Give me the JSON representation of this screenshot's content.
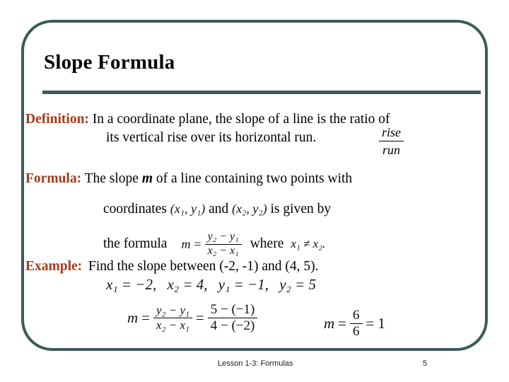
{
  "slide": {
    "title": "Slope Formula",
    "accent_color": "#3b5b59",
    "label_color": "#a63a1b",
    "text_color": "#000000",
    "background_color": "#ffffff"
  },
  "definition": {
    "label": "Definition:",
    "line1": "In a coordinate plane, the slope of a line is the ratio of",
    "line2": "its vertical rise over its horizontal run.",
    "fraction": {
      "numerator": "rise",
      "denominator": "run"
    }
  },
  "formula": {
    "label": "Formula:",
    "line1_before_m": "The slope",
    "m_symbol": "m",
    "line1_after_m": "of a line containing two points with",
    "line2_prefix": "coordinates",
    "point1": "(x₁, y₁)",
    "point2": "(x₂, y₂)",
    "line2_conjunction": "and",
    "line2_suffix": "is given by",
    "line3_prefix": "the formula",
    "m_var": "m",
    "equals": "=",
    "numerator": "y₂ − y₁",
    "denominator": "x₂ − x₁",
    "line3_where": "where",
    "condition": "x₁ ≠ x₂.",
    "num_y2": "y",
    "num_y2_sub": "2",
    "num_minus": "−",
    "num_y1": "y",
    "num_y1_sub": "1",
    "den_x2": "x",
    "den_x2_sub": "2",
    "den_minus": "−",
    "den_x1": "x",
    "den_x1_sub": "1"
  },
  "example": {
    "label": "Example:",
    "prompt": "Find the slope between (-2, -1) and (4, 5).",
    "values": {
      "x1": "x₁ = −2,",
      "x2": "x₂ = 4,",
      "y1": "y₁ = −1,",
      "y2": "y₂ = 5"
    },
    "work": {
      "m": "m",
      "eq1": "=",
      "frac1_num": "y₂ − y₁",
      "frac1_den": "x₂ − x₁",
      "eq2": "=",
      "frac2_num": "5 − (−1)",
      "frac2_den": "4 − (−2)"
    },
    "result": {
      "m": "m",
      "eq1": "=",
      "frac_num": "6",
      "frac_den": "6",
      "eq2": "=",
      "value": "1"
    }
  },
  "footer": {
    "lesson": "Lesson 1-3: Formulas",
    "page": "5"
  }
}
